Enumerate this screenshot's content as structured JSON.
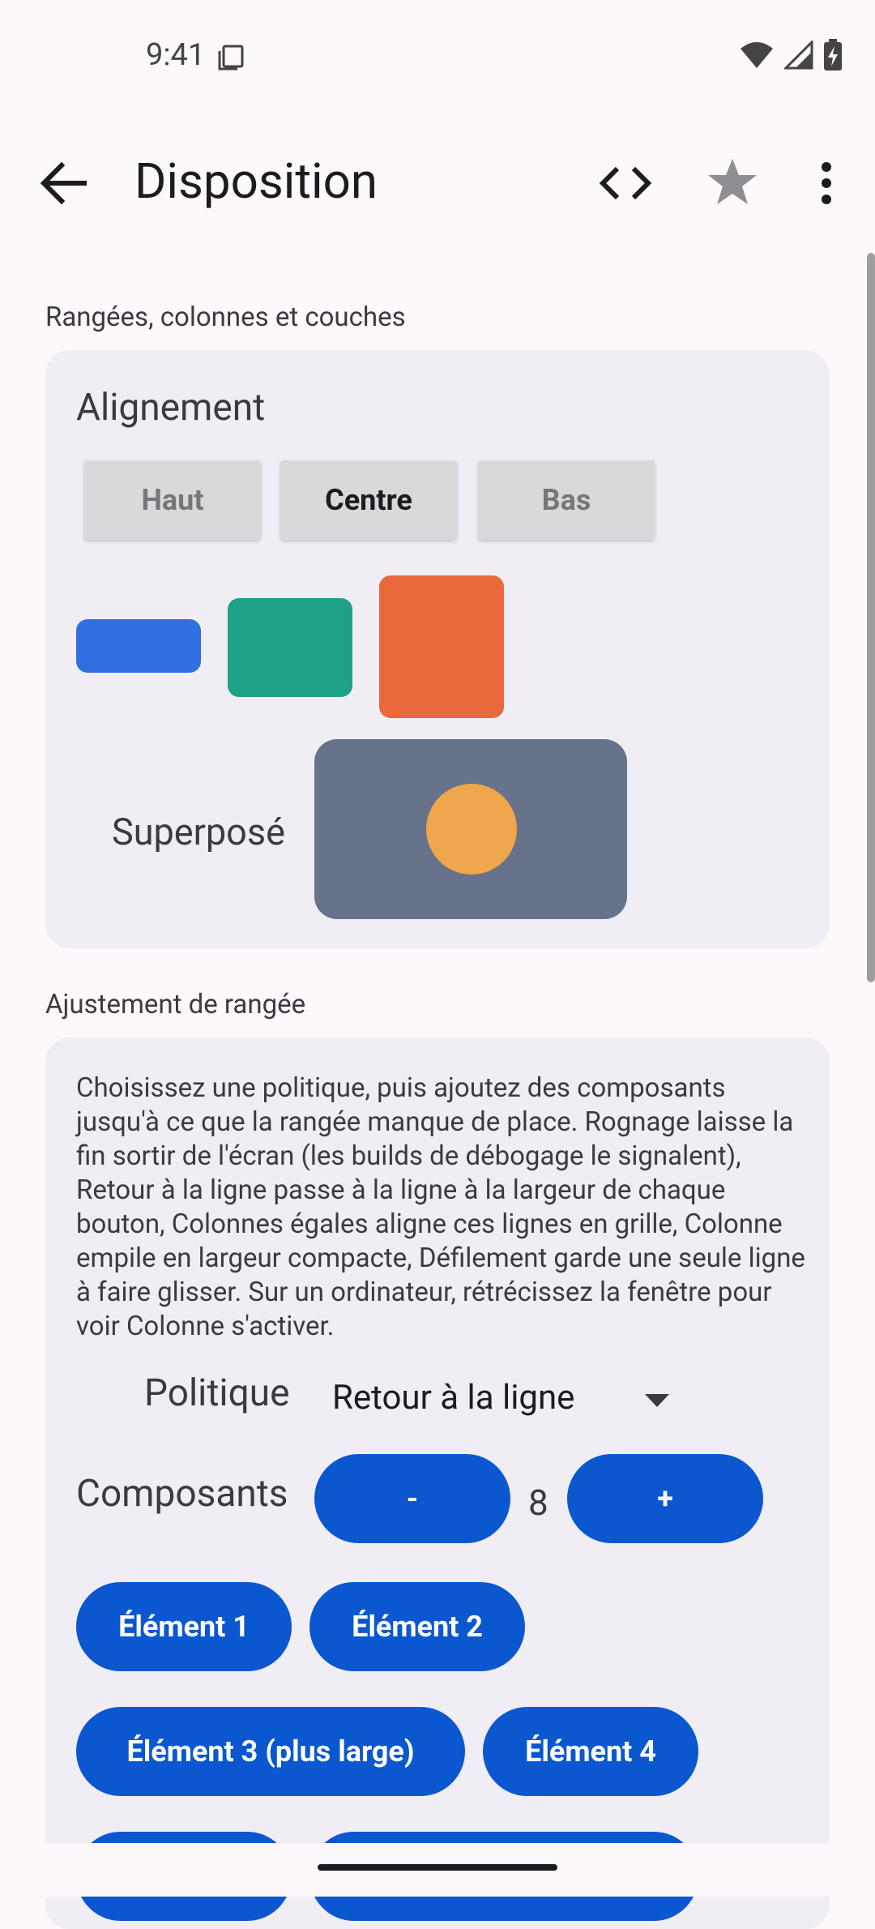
{
  "status": {
    "time": "9:41"
  },
  "app_bar": {
    "title": "Disposition"
  },
  "icons": {
    "back": "arrow-back-icon",
    "code": "code-icon",
    "star": "star-icon",
    "more": "more-vert-icon"
  },
  "section1": {
    "label": "Rangées, colonnes et couches",
    "card_title": "Alignement",
    "segments": [
      "Haut",
      "Centre",
      "Bas"
    ],
    "selected_segment": "Centre",
    "overlay_label": "Superposé"
  },
  "colors": {
    "blue": "#2f6fe0",
    "teal": "#1ea187",
    "orange": "#e8693c",
    "slate": "#66738a",
    "amber": "#f0a64c",
    "primary": "#0b57d0"
  },
  "section2": {
    "label": "Ajustement de rangée",
    "help": "Choisissez une politique, puis ajoutez des composants jusqu'à ce que la rangée manque de place. Rognage laisse la fin sortir de l'écran (les builds de débogage le signalent), Retour à la ligne passe à la ligne à la largeur de chaque bouton, Colonnes égales aligne ces lignes en grille, Colonne empile en largeur compacte, Défilement garde une seule ligne à faire glisser. Sur un ordinateur, rétrécissez la fenêtre pour voir Colonne s'activer.",
    "policy_label": "Politique",
    "policy_value": "Retour à la ligne",
    "components_label": "Composants",
    "minus": "-",
    "plus": "+",
    "count": "8",
    "items": [
      "Élément 1",
      "Élément 2",
      "Élément 3 (plus large)",
      "Élément 4"
    ]
  }
}
